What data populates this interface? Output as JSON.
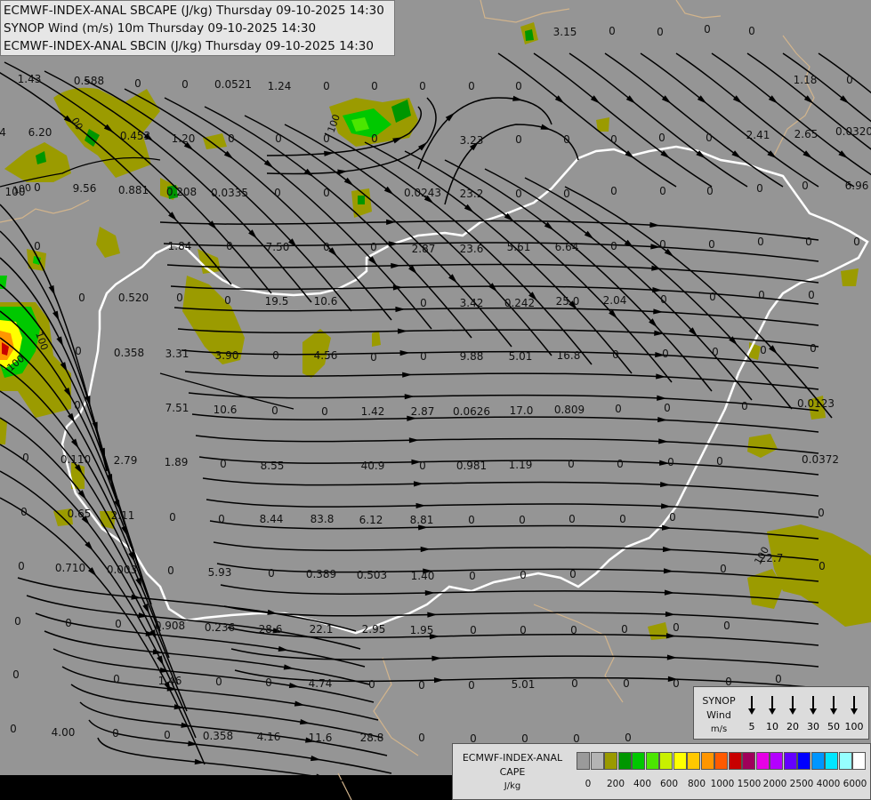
{
  "titles": [
    "ECMWF-INDEX-ANAL SBCAPE (J/kg) Thursday 09-10-2025 14:30",
    "SYNOP Wind (m/s) 10m Thursday 09-10-2025 14:30",
    "ECMWF-INDEX-ANAL SBCIN (J/kg) Thursday 09-10-2025 14:30"
  ],
  "wind_legend": {
    "title": "SYNOP",
    "subtitle": "Wind",
    "unit": "m/s",
    "speeds": [
      "5",
      "10",
      "20",
      "30",
      "50",
      "100"
    ]
  },
  "cape_legend": {
    "title": "ECMWF-INDEX-ANAL",
    "subtitle": "CAPE",
    "unit": "J/kg",
    "colors": [
      "#9a9a9a",
      "#b4b4b4",
      "#9a9a00",
      "#009600",
      "#00c800",
      "#4be600",
      "#c8f000",
      "#ffff00",
      "#ffc800",
      "#ff9600",
      "#ff5a00",
      "#c80000",
      "#a0005a",
      "#e600e6",
      "#b400ff",
      "#6400ff",
      "#0000ff",
      "#0096ff",
      "#00e6ff",
      "#96ffff",
      "#ffffff"
    ],
    "tick_labels": [
      "0",
      "200",
      "400",
      "600",
      "800",
      "1000",
      "1500",
      "2000",
      "2500",
      "4000",
      "6000"
    ]
  },
  "cin_values": [
    "1.43",
    "0.588",
    "0",
    "0",
    "0.0521",
    "1.24",
    "0",
    "0",
    "0",
    "0",
    "0",
    "3.15",
    "0",
    "0",
    "0",
    "0",
    "1.18",
    "0",
    "4",
    "6.20",
    "0.453",
    "1.20",
    "0",
    "0",
    "0",
    "0",
    "3.23",
    "0",
    "0",
    "0",
    "0",
    "0",
    "2.41",
    "2.65",
    "0.0320",
    "100",
    "0",
    "9.56",
    "0.881",
    "0.208",
    "0.0335",
    "0",
    "0",
    "0.0243",
    "23.2",
    "0",
    "0",
    "0",
    "0",
    "0",
    "0",
    "0",
    "6.96",
    "0",
    "1.84",
    "0",
    "7.50",
    "0",
    "0",
    "2.87",
    "23.6",
    "5.61",
    "6.64",
    "0",
    "0",
    "0",
    "0",
    "0",
    "0",
    "0",
    "0.520",
    "0",
    "0",
    "19.5",
    "10.6",
    "0",
    "3.42",
    "0.242",
    "25.0",
    "2.04",
    "0",
    "0",
    "0",
    "0",
    "0",
    "0.358",
    "3.31",
    "3.90",
    "0",
    "4.56",
    "0",
    "0",
    "9.88",
    "5.01",
    "16.8",
    "0",
    "0",
    "0",
    "0",
    "0",
    "0",
    "7.51",
    "10.6",
    "0",
    "0",
    "1.42",
    "2.87",
    "0.0626",
    "17.0",
    "0.809",
    "0",
    "0",
    "0",
    "0.0123",
    "0",
    "0.110",
    "2.79",
    "1.89",
    "0",
    "8.55",
    "40.9",
    "0",
    "0.981",
    "1.19",
    "0",
    "0",
    "0",
    "0",
    "0.0372",
    "0",
    "0.65",
    "2.11",
    "0",
    "0",
    "8.44",
    "83.8",
    "6.12",
    "8.81",
    "0",
    "0",
    "0",
    "0",
    "0",
    "0",
    "0",
    "0.710",
    "0.003",
    "0",
    "5.93",
    "0",
    "0.389",
    "0.503",
    "1.40",
    "0",
    "0",
    "0",
    "0",
    "22.7",
    "0",
    "0",
    "0",
    "0",
    "0.908",
    "0.236",
    "28.6",
    "22.1",
    "2.95",
    "1.95",
    "0",
    "0",
    "0",
    "0",
    "0",
    "0",
    "0",
    "0",
    "1.46",
    "0",
    "0",
    "4.74",
    "0",
    "0",
    "0",
    "5.01",
    "0",
    "0",
    "0",
    "0",
    "0",
    "0",
    "4.00",
    "0",
    "0",
    "0.358",
    "4.16",
    "11.6",
    "28.8",
    "0",
    "0",
    "0",
    "0",
    "0",
    "0"
  ],
  "contour_labels": [
    "00",
    "100",
    "100",
    "100",
    "100",
    "100",
    "100"
  ]
}
